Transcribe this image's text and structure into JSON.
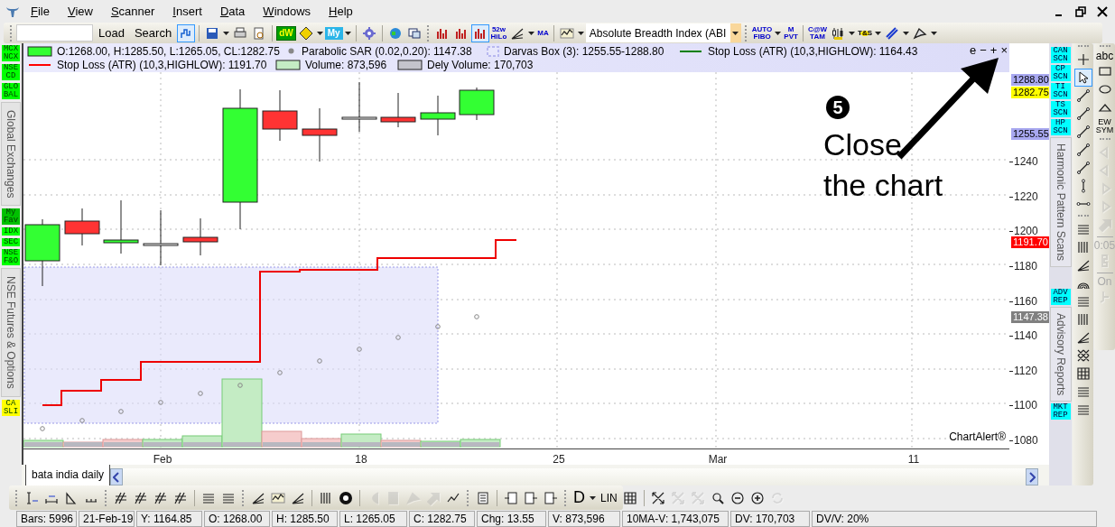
{
  "menu": {
    "items": [
      "File",
      "View",
      "Scanner",
      "Insert",
      "Data",
      "Windows",
      "Help"
    ]
  },
  "toolbar": {
    "load": "Load",
    "search": "Search",
    "items": [
      {
        "kind": "icon",
        "selected": true
      },
      {
        "kind": "sep"
      },
      {
        "kind": "icon",
        "selected": false
      },
      {
        "kind": "icon",
        "selected": false
      },
      {
        "kind": "icon",
        "selected": false
      },
      {
        "kind": "icon",
        "selected": false
      },
      {
        "kind": "sep"
      },
      {
        "kind": "label",
        "text": "dW"
      },
      {
        "kind": "icon",
        "selected": false
      },
      {
        "kind": "icon",
        "selected": false
      },
      {
        "kind": "label",
        "text": "My"
      },
      {
        "kind": "icon",
        "selected": false
      },
      {
        "kind": "sep"
      },
      {
        "kind": "icon",
        "selected": false
      },
      {
        "kind": "sep"
      },
      {
        "kind": "icon",
        "selected": false
      },
      {
        "kind": "icon",
        "selected": false
      },
      {
        "kind": "grip"
      },
      {
        "kind": "icon",
        "selected": false
      },
      {
        "kind": "icon",
        "selected": false
      },
      {
        "kind": "icon",
        "selected": true
      },
      {
        "kind": "label",
        "text": "52w\nHiLo"
      },
      {
        "kind": "icon",
        "selected": false
      },
      {
        "kind": "icon",
        "selected": false
      },
      {
        "kind": "label",
        "text": "MA"
      },
      {
        "kind": "sep"
      },
      {
        "kind": "icon",
        "selected": false
      },
      {
        "kind": "icon",
        "selected": false
      },
      {
        "kind": "select",
        "text": "Absolute Breadth Index (ABI"
      },
      {
        "kind": "grip"
      },
      {
        "kind": "label",
        "text": "AUTO\nFIBO"
      },
      {
        "kind": "icon",
        "selected": false
      },
      {
        "kind": "label",
        "text": "M\nPVT"
      },
      {
        "kind": "sep"
      },
      {
        "kind": "label",
        "text": "C@W\nTAM"
      },
      {
        "kind": "icon",
        "selected": false
      },
      {
        "kind": "icon",
        "selected": false
      },
      {
        "kind": "label",
        "text": "T&S"
      },
      {
        "kind": "icon",
        "selected": false
      },
      {
        "kind": "icon",
        "selected": false
      },
      {
        "kind": "icon",
        "selected": false
      },
      {
        "kind": "icon",
        "selected": false
      },
      {
        "kind": "icon",
        "selected": false
      }
    ]
  },
  "left_sidebar": [
    {
      "kind": "button",
      "text": "MCX\nNCX",
      "color": "#00ff00"
    },
    {
      "kind": "button",
      "text": "NSE\nCD",
      "color": "#00ff00"
    },
    {
      "kind": "button",
      "text": "GLO\nBAL",
      "color": "#00ff00"
    },
    {
      "kind": "tab",
      "text": "Global Exchanges"
    },
    {
      "kind": "button",
      "text": "My\nFav",
      "color": "#00c000"
    },
    {
      "kind": "button",
      "text": "IDX",
      "color": "#00ff00"
    },
    {
      "kind": "button",
      "text": "SEC",
      "color": "#00ff00"
    },
    {
      "kind": "button",
      "text": "NSE\nF&O",
      "color": "#00ff00"
    },
    {
      "kind": "tab",
      "text": "NSE Futures & Options"
    },
    {
      "kind": "button",
      "text": "CA\nSLI",
      "color": "#ffff00"
    }
  ],
  "chart": {
    "legend": [
      [
        {
          "kind": "box",
          "color": "#33ff33",
          "text": "O:1268.00, H:1285.50, L:1265.05, CL:1282.75"
        },
        {
          "kind": "dot",
          "color": "#888888",
          "text": "Parabolic SAR (0.02,0.20): 1147.38"
        },
        {
          "kind": "dashed",
          "color": "#b8b8f0",
          "text": "Darvas Box (3): 1255.55-1288.80"
        },
        {
          "kind": "line",
          "color": "#008000",
          "text": "Stop Loss (ATR) (10,3,HIGHLOW): 1164.43"
        }
      ],
      [
        {
          "kind": "line",
          "color": "#ff0000",
          "text": "Stop Loss (ATR) (10,3,HIGHLOW): 1191.70"
        },
        {
          "kind": "box",
          "color": "#c4ecc4",
          "text": "Volume: 873,596"
        },
        {
          "kind": "box",
          "color": "#c4c4cc",
          "text": "Dely Volume: 170,703"
        }
      ]
    ],
    "controls": [
      "e",
      "−",
      "+",
      "×"
    ],
    "annotation": {
      "number": "5",
      "text": "Close\nthe chart"
    },
    "brand": "ChartAlert®",
    "price_ticks": [
      "1240",
      "1220",
      "1200",
      "1180",
      "1160",
      "1140",
      "1120",
      "1100",
      "1080"
    ],
    "price_flags": [
      {
        "text": "1288.80",
        "color": "#a8a8f0"
      },
      {
        "text": "1282.75",
        "color": "#ffff00"
      },
      {
        "text": "1255.55",
        "color": "#a8a8f0"
      },
      {
        "text": "1191.70",
        "color": "#ff0000"
      },
      {
        "text": "1147.38",
        "color": "#808080"
      }
    ],
    "date_ticks": [
      "Feb",
      "18",
      "25",
      "Mar",
      "11"
    ]
  },
  "right_panel": {
    "scans": [
      {
        "kind": "button",
        "text": "CAN\nSCN"
      },
      {
        "kind": "button",
        "text": "CP\nSCN"
      },
      {
        "kind": "button",
        "text": "TI\nSCN"
      },
      {
        "kind": "button",
        "text": "TS\nSCN"
      },
      {
        "kind": "button",
        "text": "HP\nSCN"
      },
      {
        "kind": "tab",
        "text": "Harmonic Pattern Scans"
      },
      {
        "kind": "gap"
      },
      {
        "kind": "button",
        "text": "ADV\nREP"
      },
      {
        "kind": "tab",
        "text": "Advisory Reports"
      },
      {
        "kind": "button",
        "text": "MKT\nREP"
      }
    ],
    "tools": [
      {
        "kind": "grip"
      },
      {
        "kind": "icon",
        "selected": false
      },
      {
        "kind": "icon",
        "selected": true
      },
      {
        "kind": "icon",
        "selected": false
      },
      {
        "kind": "icon",
        "selected": false
      },
      {
        "kind": "icon",
        "selected": false
      },
      {
        "kind": "icon",
        "selected": false
      },
      {
        "kind": "icon",
        "selected": false
      },
      {
        "kind": "icon",
        "selected": false
      },
      {
        "kind": "icon",
        "selected": false
      },
      {
        "kind": "grip"
      },
      {
        "kind": "icon",
        "selected": false
      },
      {
        "kind": "icon",
        "selected": false
      },
      {
        "kind": "icon",
        "selected": false
      },
      {
        "kind": "icon",
        "selected": false
      },
      {
        "kind": "icon",
        "selected": false
      },
      {
        "kind": "icon",
        "selected": false
      },
      {
        "kind": "icon",
        "selected": false
      },
      {
        "kind": "icon",
        "selected": false
      },
      {
        "kind": "icon",
        "selected": false
      },
      {
        "kind": "icon",
        "selected": false
      },
      {
        "kind": "icon",
        "selected": false
      }
    ],
    "shapes": [
      {
        "kind": "grip"
      },
      {
        "kind": "label",
        "text": "abc",
        "disabled": false
      },
      {
        "kind": "icon",
        "disabled": false
      },
      {
        "kind": "icon",
        "disabled": false
      },
      {
        "kind": "icon",
        "disabled": false
      },
      {
        "kind": "label",
        "text": "EW\nSYM",
        "disabled": false
      },
      {
        "kind": "grip"
      },
      {
        "kind": "icon",
        "disabled": true
      },
      {
        "kind": "icon",
        "disabled": true
      },
      {
        "kind": "icon",
        "disabled": true
      },
      {
        "kind": "icon",
        "disabled": true
      },
      {
        "kind": "icon",
        "disabled": true
      },
      {
        "kind": "sep"
      },
      {
        "kind": "label",
        "text": "0:05",
        "disabled": true
      },
      {
        "kind": "icon",
        "disabled": true
      },
      {
        "kind": "sep"
      },
      {
        "kind": "label",
        "text": "On",
        "disabled": true
      },
      {
        "kind": "icon",
        "disabled": true
      }
    ]
  },
  "tabs": [
    {
      "label": "bata india daily",
      "selected": true
    }
  ],
  "bottom_toolbar": [
    {
      "kind": "grip"
    },
    {
      "kind": "icon",
      "disabled": false
    },
    {
      "kind": "icon",
      "disabled": false
    },
    {
      "kind": "icon",
      "disabled": false
    },
    {
      "kind": "icon",
      "disabled": false
    },
    {
      "kind": "grip"
    },
    {
      "kind": "icon",
      "disabled": false
    },
    {
      "kind": "icon",
      "disabled": false
    },
    {
      "kind": "icon",
      "disabled": false
    },
    {
      "kind": "icon",
      "disabled": false
    },
    {
      "kind": "sep"
    },
    {
      "kind": "icon",
      "disabled": false
    },
    {
      "kind": "icon",
      "disabled": false
    },
    {
      "kind": "grip"
    },
    {
      "kind": "icon",
      "disabled": false
    },
    {
      "kind": "icon",
      "disabled": false
    },
    {
      "kind": "icon",
      "disabled": false
    },
    {
      "kind": "sep"
    },
    {
      "kind": "icon",
      "disabled": false
    },
    {
      "kind": "icon",
      "disabled": false
    },
    {
      "kind": "sep"
    },
    {
      "kind": "icon",
      "disabled": true
    },
    {
      "kind": "icon",
      "disabled": true
    },
    {
      "kind": "icon",
      "disabled": true
    },
    {
      "kind": "icon",
      "disabled": true
    },
    {
      "kind": "icon",
      "disabled": false
    },
    {
      "kind": "grip"
    },
    {
      "kind": "icon",
      "disabled": false
    },
    {
      "kind": "sep"
    },
    {
      "kind": "icon",
      "disabled": false
    },
    {
      "kind": "icon",
      "disabled": false
    },
    {
      "kind": "icon",
      "disabled": false
    },
    {
      "kind": "grip"
    },
    {
      "kind": "label",
      "text": "D",
      "disabled": false
    },
    {
      "kind": "icon",
      "disabled": false
    },
    {
      "kind": "label",
      "text": "LIN",
      "disabled": false
    },
    {
      "kind": "icon",
      "disabled": false
    },
    {
      "kind": "sep"
    },
    {
      "kind": "icon",
      "disabled": false
    },
    {
      "kind": "icon",
      "disabled": true
    },
    {
      "kind": "icon",
      "disabled": true
    },
    {
      "kind": "icon",
      "disabled": false
    },
    {
      "kind": "icon",
      "disabled": false
    },
    {
      "kind": "icon",
      "disabled": false
    },
    {
      "kind": "icon",
      "disabled": true
    }
  ],
  "status_bar": [
    "Bars: 5996",
    "21-Feb-19",
    "Y: 1164.85",
    "O: 1268.00",
    "H: 1285.50",
    "L: 1265.05",
    "C: 1282.75",
    "Chg: 13.55",
    "V: 873,596",
    "10MA-V: 1,743,075",
    "DV: 170,703",
    "DV/V: 20%"
  ]
}
